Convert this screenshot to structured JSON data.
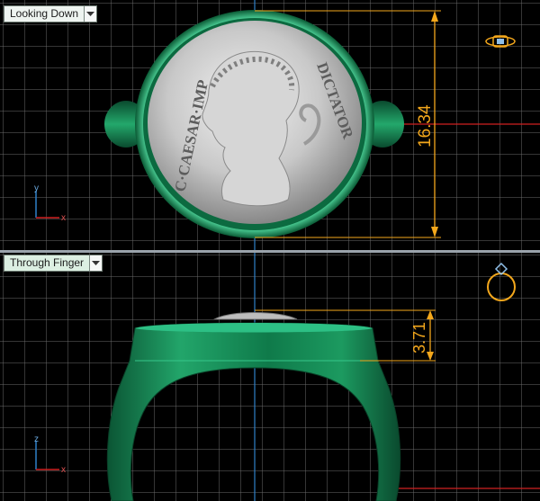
{
  "viewports": {
    "top": {
      "label": "Looking Down",
      "dimension": "16.34"
    },
    "bottom": {
      "label": "Through Finger",
      "dimension": "3.71"
    }
  },
  "axes": {
    "top": {
      "vertical": "y",
      "horizontal": "x"
    },
    "bottom": {
      "vertical": "z",
      "horizontal": "x"
    }
  },
  "coin": {
    "inscription_left": "C·CAESAR·IMP",
    "inscription_right": "DICTATOR"
  },
  "colors": {
    "grid": "#707070",
    "ring_green": "#1f9a63",
    "dimension": "#f3a71c",
    "axis_red": "#d02020",
    "axis_blue": "#2f80c8",
    "label_bg": "#dcefe2"
  },
  "icons": {
    "top_corner": "ring-top-view-icon",
    "bottom_corner": "ring-side-view-icon",
    "dropdown": "chevron-down-icon"
  }
}
